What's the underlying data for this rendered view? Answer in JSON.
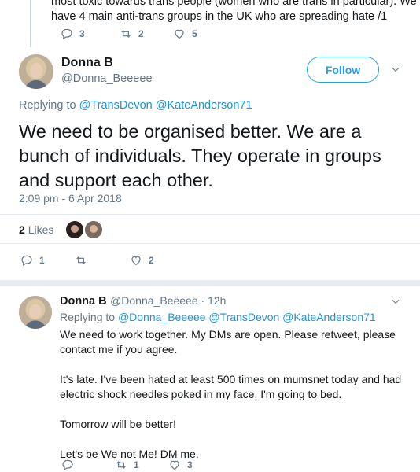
{
  "previous_tweet": {
    "line1": "most toxic towards trans people (women who are trans in particular). We now",
    "line2": "have 4 main anti-trans groups in the UK who are spreading hate /1",
    "reply_count": "3",
    "retweet_count": "2",
    "like_count": "5"
  },
  "main_tweet": {
    "name": "Donna B",
    "handle": "@Donna_Beeeee",
    "follow_label": "Follow",
    "replying_prefix": "Replying to",
    "replying_users": "@TransDevon @KateAnderson71",
    "text": "We need to be organised better. We are a bunch of individuals. They operate in groups and support each other.",
    "timestamp": "2:09 pm - 6 Apr 2018",
    "likes_count": "2",
    "likes_label": "Likes",
    "reply_count": "1",
    "retweet_count": "",
    "like_count": "2"
  },
  "reply_tweet": {
    "name": "Donna B",
    "handle_time": "@Donna_Beeeee · 12h",
    "replying_prefix": "Replying to",
    "replying_users": "@Donna_Beeeee @TransDevon @KateAnderson71",
    "para1": "We need to work together. My DMs are open. Please retweet, please contact me if you agree.",
    "para2": "It's late. I've been hated at least 500 times on mumsnet today and had electric shock needles poked in my face. I'm going to bed.",
    "para3": "Tomorrow will be better!",
    "para4": "Let's be We not Me! DM me.",
    "reply_count": "",
    "retweet_count": "1",
    "like_count": "3"
  },
  "colors": {
    "accent": "#1da1f2",
    "link": "#1b95e0",
    "muted": "#657786",
    "divider": "#e6ecf0"
  },
  "icons": [
    "reply-icon",
    "retweet-icon",
    "heart-icon",
    "chevron-down-icon"
  ]
}
